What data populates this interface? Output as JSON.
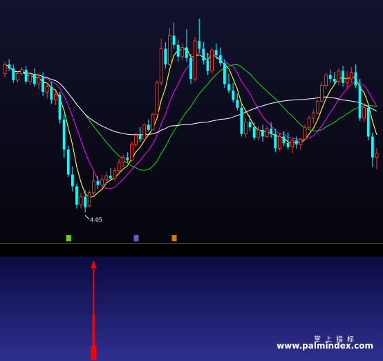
{
  "chart_data": {
    "type": "candlestick",
    "main_panel": {
      "candles": [
        [
          4.93,
          5.02,
          4.9,
          5.0
        ],
        [
          5.0,
          5.04,
          4.95,
          4.97
        ],
        [
          4.97,
          5.0,
          4.86,
          4.88
        ],
        [
          4.88,
          4.95,
          4.86,
          4.93
        ],
        [
          4.93,
          4.98,
          4.92,
          4.96
        ],
        [
          4.96,
          4.99,
          4.85,
          4.87
        ],
        [
          4.87,
          4.94,
          4.84,
          4.92
        ],
        [
          4.92,
          4.97,
          4.83,
          4.85
        ],
        [
          4.85,
          4.93,
          4.81,
          4.9
        ],
        [
          4.9,
          4.94,
          4.76,
          4.79
        ],
        [
          4.79,
          4.86,
          4.74,
          4.83
        ],
        [
          4.83,
          4.87,
          4.7,
          4.73
        ],
        [
          4.73,
          4.8,
          4.69,
          4.77
        ],
        [
          4.77,
          4.79,
          4.55,
          4.58
        ],
        [
          4.58,
          4.62,
          4.29,
          4.35
        ],
        [
          4.35,
          4.38,
          4.14,
          4.16
        ],
        [
          4.16,
          4.22,
          4.03,
          4.07
        ],
        [
          4.07,
          4.09,
          3.9,
          3.93
        ],
        [
          3.93,
          4.02,
          3.9,
          3.99
        ],
        [
          3.99,
          4.04,
          3.87,
          3.91
        ],
        [
          3.92,
          4.04,
          3.91,
          4.02
        ],
        [
          4.02,
          4.18,
          4.0,
          4.11
        ],
        [
          4.11,
          4.15,
          4.05,
          4.08
        ],
        [
          4.08,
          4.16,
          4.06,
          4.12
        ],
        [
          4.12,
          4.18,
          4.09,
          4.15
        ],
        [
          4.15,
          4.21,
          4.12,
          4.13
        ],
        [
          4.13,
          4.21,
          4.11,
          4.19
        ],
        [
          4.19,
          4.28,
          4.17,
          4.25
        ],
        [
          4.25,
          4.31,
          4.22,
          4.29
        ],
        [
          4.29,
          4.33,
          4.25,
          4.27
        ],
        [
          4.27,
          4.41,
          4.26,
          4.39
        ],
        [
          4.39,
          4.48,
          4.37,
          4.46
        ],
        [
          4.46,
          4.52,
          4.41,
          4.43
        ],
        [
          4.43,
          4.55,
          4.42,
          4.54
        ],
        [
          4.54,
          4.58,
          4.49,
          4.5
        ],
        [
          4.5,
          4.63,
          4.5,
          4.62
        ],
        [
          4.62,
          4.88,
          4.62,
          4.86
        ],
        [
          4.86,
          5.2,
          4.84,
          5.12
        ],
        [
          5.12,
          5.17,
          4.97,
          5.0
        ],
        [
          5.0,
          5.28,
          4.99,
          5.22
        ],
        [
          5.22,
          5.32,
          5.12,
          5.15
        ],
        [
          5.15,
          5.19,
          5.02,
          5.06
        ],
        [
          5.06,
          5.16,
          5.03,
          5.13
        ],
        [
          5.13,
          5.27,
          5.02,
          5.05
        ],
        [
          5.05,
          5.08,
          4.85,
          4.89
        ],
        [
          4.89,
          5.21,
          4.87,
          5.18
        ],
        [
          5.18,
          5.35,
          5.09,
          5.12
        ],
        [
          5.12,
          5.17,
          5.0,
          5.03
        ],
        [
          5.03,
          5.09,
          4.92,
          4.95
        ],
        [
          4.95,
          5.13,
          4.93,
          5.11
        ],
        [
          5.11,
          5.16,
          5.04,
          5.07
        ],
        [
          5.07,
          5.13,
          4.99,
          5.01
        ],
        [
          5.01,
          5.04,
          4.82,
          4.85
        ],
        [
          4.85,
          4.93,
          4.78,
          4.8
        ],
        [
          4.8,
          4.86,
          4.71,
          4.73
        ],
        [
          4.73,
          4.78,
          4.65,
          4.67
        ],
        [
          4.67,
          4.7,
          4.45,
          4.47
        ],
        [
          4.47,
          4.59,
          4.44,
          4.56
        ],
        [
          4.56,
          4.61,
          4.49,
          4.52
        ],
        [
          4.52,
          4.56,
          4.42,
          4.44
        ],
        [
          4.44,
          4.53,
          4.42,
          4.5
        ],
        [
          4.5,
          4.54,
          4.41,
          4.45
        ],
        [
          4.45,
          4.53,
          4.44,
          4.51
        ],
        [
          4.51,
          4.56,
          4.44,
          4.47
        ],
        [
          4.47,
          4.51,
          4.33,
          4.36
        ],
        [
          4.36,
          4.47,
          4.34,
          4.45
        ],
        [
          4.45,
          4.49,
          4.38,
          4.4
        ],
        [
          4.4,
          4.48,
          4.35,
          4.37
        ],
        [
          4.37,
          4.44,
          4.32,
          4.42
        ],
        [
          4.42,
          4.45,
          4.36,
          4.39
        ],
        [
          4.39,
          4.44,
          4.35,
          4.43
        ],
        [
          4.43,
          4.54,
          4.42,
          4.52
        ],
        [
          4.52,
          4.61,
          4.5,
          4.59
        ],
        [
          4.59,
          4.66,
          4.55,
          4.63
        ],
        [
          4.63,
          4.73,
          4.62,
          4.72
        ],
        [
          4.72,
          4.87,
          4.71,
          4.84
        ],
        [
          4.84,
          4.94,
          4.81,
          4.92
        ],
        [
          4.92,
          4.96,
          4.86,
          4.89
        ],
        [
          4.89,
          4.94,
          4.85,
          4.87
        ],
        [
          4.87,
          4.97,
          4.84,
          4.95
        ],
        [
          4.95,
          4.99,
          4.83,
          4.86
        ],
        [
          4.86,
          4.95,
          4.81,
          4.89
        ],
        [
          4.89,
          4.98,
          4.86,
          4.94
        ],
        [
          4.94,
          5.0,
          4.82,
          4.84
        ],
        [
          4.84,
          4.89,
          4.57,
          4.59
        ],
        [
          4.59,
          4.71,
          4.56,
          4.67
        ],
        [
          4.67,
          4.7,
          4.42,
          4.45
        ],
        [
          4.45,
          4.48,
          4.22,
          4.29
        ],
        [
          4.29,
          4.36,
          4.2,
          4.32
        ]
      ],
      "yrange": [
        3.75,
        5.45
      ],
      "low_label": "4.05",
      "ma_colors": [
        "#f5f5f5",
        "#ffff00",
        "#ff00ff",
        "#00e600",
        "#ffffff"
      ],
      "candle_up_color": "#ff3232",
      "candle_down_color": "#00ffff",
      "markers": [
        {
          "text": "■",
          "index": 15,
          "color": "#7cfc00"
        },
        {
          "text": "■",
          "index": 31,
          "color": "#7b68ee"
        },
        {
          "text": "■",
          "index": 40,
          "color": "#ff8c00"
        }
      ]
    },
    "sub_panel": {
      "signal_index": 21,
      "signal_color": "#ff0000"
    }
  },
  "watermark": {
    "title": "掌上指标",
    "url": "www.palmindex.com"
  }
}
